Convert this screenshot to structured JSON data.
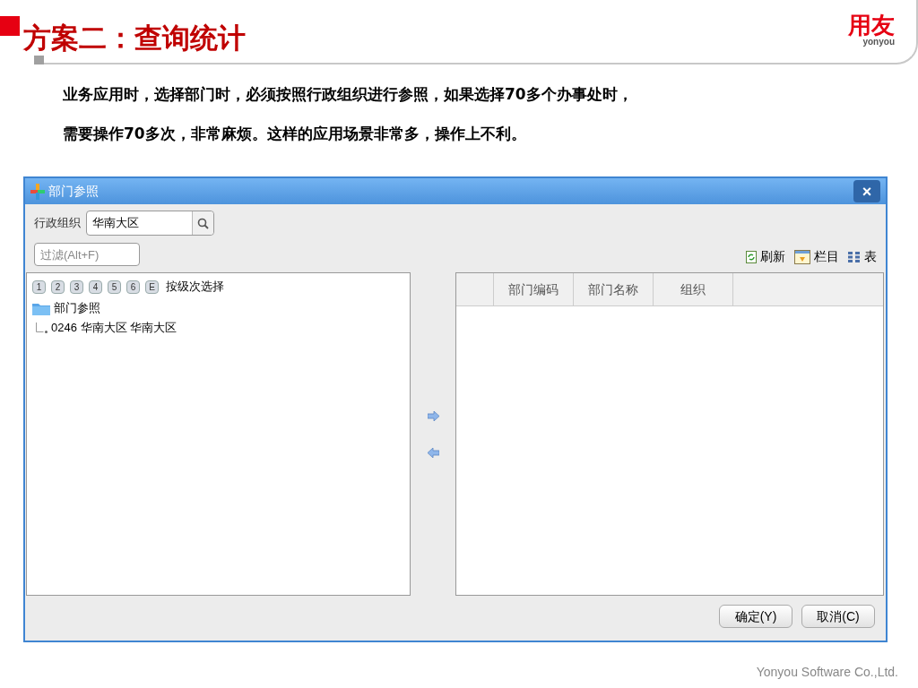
{
  "slide": {
    "title": "方案二：查询统计",
    "logo": {
      "mark": "用友",
      "wordmark": "yonyou"
    },
    "paragraph_lines": [
      "业务应用时，选择部门时，必须按照行政组织进行参照，如果选择70多个办事处时，",
      "需要操作70多次，非常麻烦。这样的应用场景非常多，操作上不利。"
    ],
    "footer": "Yonyou Software Co.,Ltd."
  },
  "dialog": {
    "title": "部门参照",
    "close": "×",
    "org_label": "行政组织",
    "org_value": "华南大区",
    "filter": {
      "placeholder": "过滤(Alt+F)"
    },
    "toolbar": [
      {
        "kind": "refresh",
        "label": "刷新"
      },
      {
        "kind": "columns",
        "label": "栏目"
      },
      {
        "kind": "table",
        "label": "表"
      }
    ],
    "levels": [
      "1",
      "2",
      "3",
      "4",
      "5",
      "6",
      "E"
    ],
    "levels_label": "按级次选择",
    "tree": [
      {
        "label": "部门参照",
        "children": [
          {
            "label": "0246 华南大区 华南大区"
          }
        ]
      }
    ],
    "table": {
      "columns": [
        "部门编码",
        "部门名称",
        "组织"
      ]
    },
    "buttons": [
      "确定(Y)",
      "取消(C)"
    ]
  }
}
